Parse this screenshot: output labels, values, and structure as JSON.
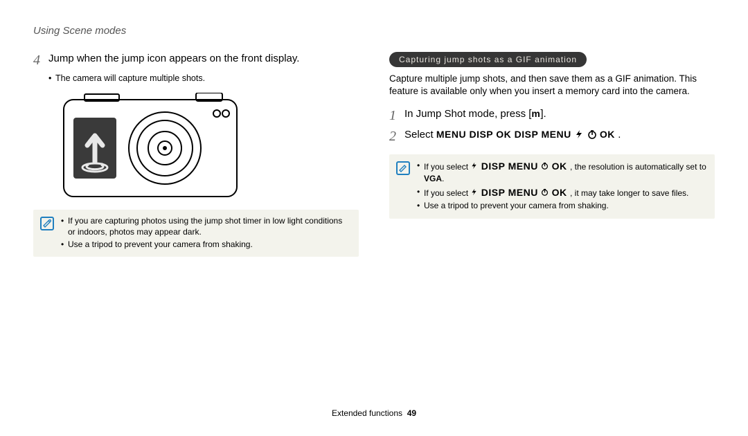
{
  "header": {
    "title": "Using Scene modes"
  },
  "left": {
    "step4": {
      "num": "4",
      "text": "Jump when the jump icon appears on the front display.",
      "bullets": [
        "The camera will capture multiple shots."
      ]
    },
    "note": {
      "items": [
        "If you are capturing photos using the jump shot timer in low light conditions or indoors, photos may appear dark.",
        "Use a tripod to prevent your camera from shaking."
      ]
    }
  },
  "right": {
    "pill": "Capturing jump shots as a GIF animation",
    "body": "Capture multiple jump shots, and then save them as a GIF animation. This feature is available only when you insert a memory card into the camera.",
    "step1": {
      "num": "1",
      "text_a": "In Jump Shot mode, press [",
      "text_b": "]."
    },
    "step2": {
      "num": "2",
      "text_a": "Select  ",
      "seq1": "MENU  DISP OK  DISP MENU",
      "seq2": "OK",
      "text_b": "  ."
    },
    "note": {
      "items": [
        {
          "a": "If you select  ",
          "seq": "DISP MENU",
          "tail": "OK",
          "b": " , the resolution is automatically set to ",
          "c": "VGA",
          "d": "."
        },
        {
          "a": "If you select  ",
          "seq": "DISP MENU",
          "tail": "OK",
          "b": " , it may take longer to save files.",
          "c": "",
          "d": ""
        },
        {
          "a": "Use a tripod to prevent your camera from shaking.",
          "seq": "",
          "tail": "",
          "b": "",
          "c": "",
          "d": ""
        }
      ]
    }
  },
  "footer": {
    "section": "Extended functions",
    "page": "49"
  }
}
